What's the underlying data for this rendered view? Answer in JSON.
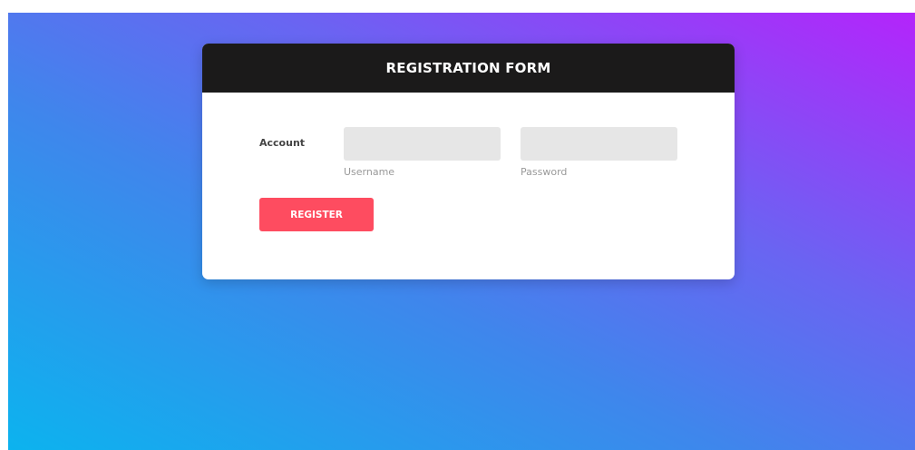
{
  "form": {
    "title": "REGISTRATION FORM",
    "account_label": "Account",
    "username": {
      "value": "",
      "hint": "Username"
    },
    "password": {
      "value": "",
      "hint": "Password"
    },
    "register_label": "REGISTER"
  },
  "colors": {
    "header_bg": "#1b1a1a",
    "button_bg": "#fe4c60",
    "input_bg": "#e6e6e6",
    "gradient_start": "#0cb3ee",
    "gradient_end": "#b424fb"
  }
}
